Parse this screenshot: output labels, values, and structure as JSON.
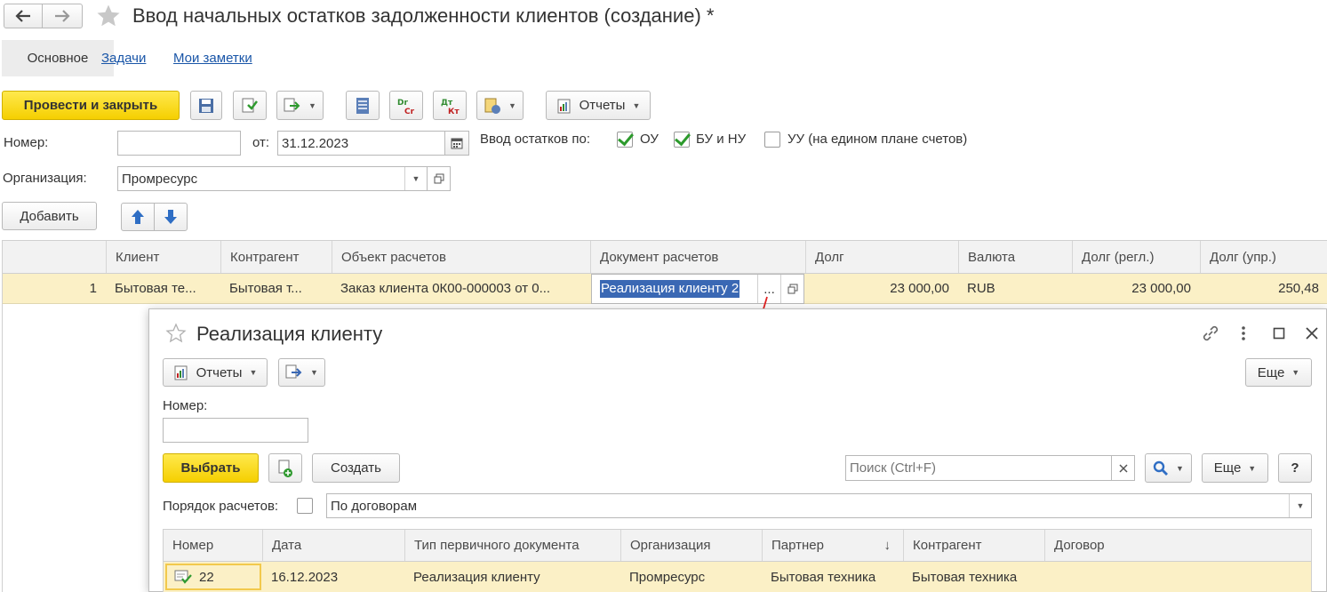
{
  "window": {
    "title": "Ввод начальных остатков задолженности клиентов (создание) *",
    "back_icon": "arrow-left-icon",
    "forward_icon": "arrow-right-icon",
    "favorite_icon": "star-icon"
  },
  "tabs": [
    {
      "label": "Основное"
    },
    {
      "label": "Задачи"
    },
    {
      "label": "Мои заметки"
    }
  ],
  "toolbar": {
    "post_close_label": "Провести и закрыть",
    "reports_label": "Отчеты"
  },
  "form": {
    "number_label": "Номер:",
    "number_value": "",
    "date_label": "от:",
    "date_value": "31.12.2023",
    "balances_label": "Ввод остатков по:",
    "chk_ou_label": "ОУ",
    "chk_bu_label": "БУ и НУ",
    "chk_uu_label": "УУ (на едином плане счетов)",
    "org_label": "Организация:",
    "org_value": "Промресурс",
    "add_label": "Добавить"
  },
  "table": {
    "columns": [
      "Клиент",
      "Контрагент",
      "Объект расчетов",
      "Документ расчетов",
      "Долг",
      "Валюта",
      "Долг (регл.)",
      "Долг (упр.)"
    ],
    "row": {
      "n": "1",
      "client": "Бытовая те...",
      "counterparty": "Бытовая т...",
      "object": "Заказ клиента 0К00-000003 от 0...",
      "document": "Реализация клиенту 2",
      "dots": "...",
      "debt": "23 000,00",
      "currency": "RUB",
      "debt_regl": "23 000,00",
      "debt_upr": "250,48"
    }
  },
  "popup": {
    "title": "Реализация клиенту",
    "reports_label": "Отчеты",
    "more_label": "Еще",
    "number_label": "Номер:",
    "number_value": "",
    "select_label": "Выбрать",
    "create_label": "Создать",
    "search_placeholder": "Поиск (Ctrl+F)",
    "more2_label": "Еще",
    "help_label": "?",
    "order_label": "Порядок расчетов:",
    "order_value": "По договорам",
    "columns": [
      "Номер",
      "Дата",
      "Тип первичного документа",
      "Организация",
      "Партнер",
      "Контрагент",
      "Договор"
    ],
    "sort_glyph": "↓",
    "row": {
      "number": "22",
      "date": "16.12.2023",
      "type": "Реализация клиенту",
      "org": "Промресурс",
      "partner": "Бытовая техника",
      "counterparty": "Бытовая техника",
      "contract": ""
    }
  },
  "colors": {
    "accent_yellow": "#f5cf00",
    "row_highlight": "#fbf0c6",
    "link_blue": "#1a56a8",
    "arrow_red": "#e02020"
  }
}
